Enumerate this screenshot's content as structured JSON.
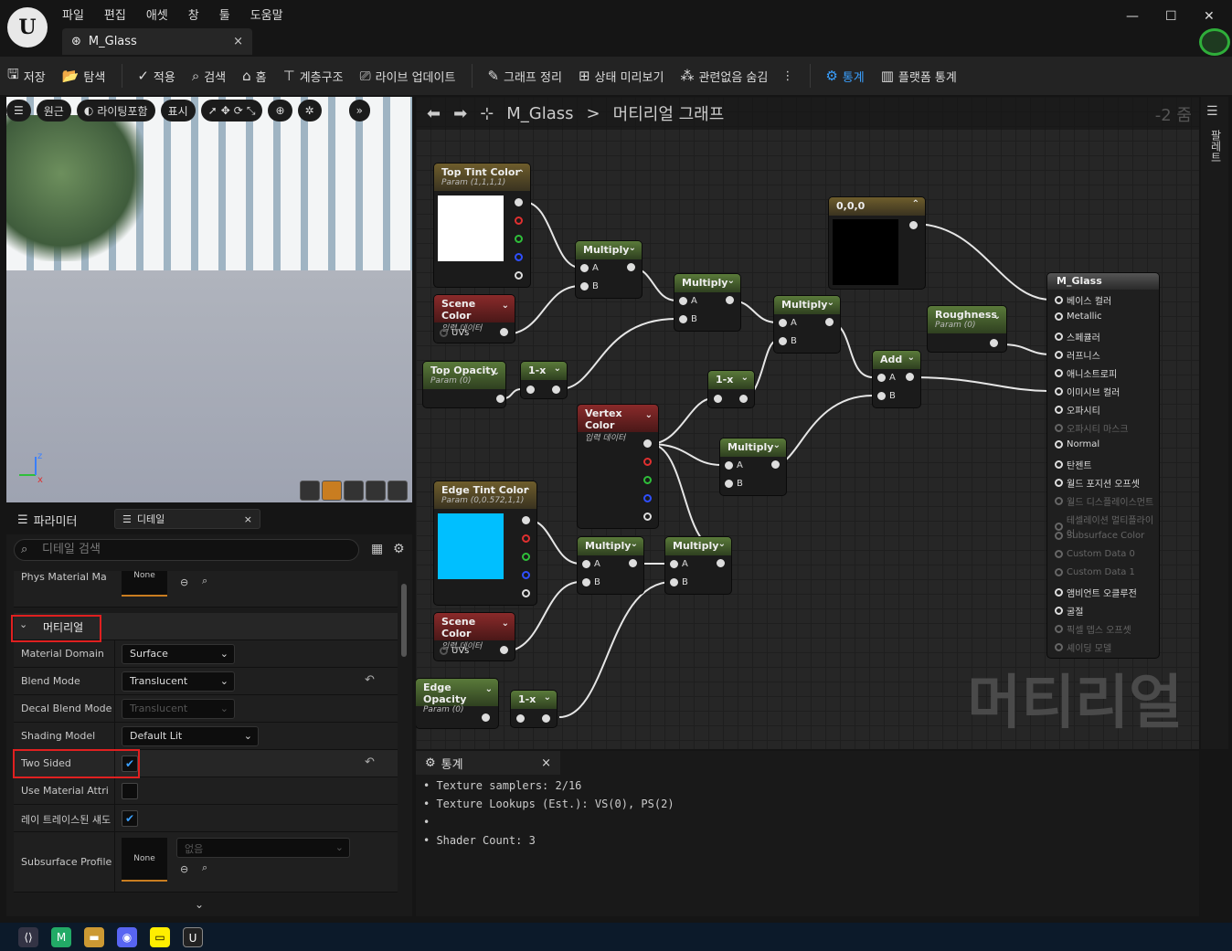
{
  "menu": [
    "파일",
    "편집",
    "애셋",
    "창",
    "툴",
    "도움말"
  ],
  "tab": {
    "title": "M_Glass",
    "close": "×"
  },
  "window_controls": [
    "—",
    "☐",
    "✕"
  ],
  "toolbar": [
    {
      "label": "저장",
      "icon": "save-icon"
    },
    {
      "label": "탐색",
      "icon": "browse-icon"
    },
    {
      "label": "적용",
      "icon": "apply-icon"
    },
    {
      "label": "검색",
      "icon": "search-icon"
    },
    {
      "label": "홈",
      "icon": "home-icon"
    },
    {
      "label": "계층구조",
      "icon": "hierarchy-icon"
    },
    {
      "label": "라이브 업데이트",
      "icon": "live-update-icon"
    },
    {
      "label": "그래프 정리",
      "icon": "clean-graph-icon"
    },
    {
      "label": "상태 미리보기",
      "icon": "preview-state-icon"
    },
    {
      "label": "관련없음 숨김",
      "icon": "hide-unrelated-icon"
    },
    {
      "label": "통계",
      "icon": "stats-icon"
    },
    {
      "label": "플랫폼 통계",
      "icon": "platform-stats-icon"
    }
  ],
  "viewport": {
    "buttons": [
      "원근",
      "라이팅포함",
      "표시"
    ]
  },
  "details": {
    "tabs": [
      "디테일",
      "파라미터"
    ],
    "tab_close": "×",
    "search_placeholder": "디테일 검색",
    "phys_label": "Phys Material Ma",
    "none": "None",
    "section": "머티리얼",
    "rows": [
      {
        "label": "Material Domain",
        "value": "Surface"
      },
      {
        "label": "Blend Mode",
        "value": "Translucent"
      },
      {
        "label": "Decal Blend Mode",
        "value": "Translucent"
      },
      {
        "label": "Shading Model",
        "value": "Default Lit"
      },
      {
        "label": "Two Sided",
        "value": "✔"
      },
      {
        "label": "Use Material Attri",
        "value": ""
      },
      {
        "label": "레이 트레이스된 섀도",
        "value": "✔"
      },
      {
        "label": "Subsurface Profile",
        "value": "없음"
      }
    ]
  },
  "graph": {
    "breadcrumb_asset": "M_Glass",
    "breadcrumb_sep": ">",
    "breadcrumb_graph": "머티리얼 그래프",
    "zoom": "-2 줌",
    "watermark": "머티리얼",
    "palette": "팔레트",
    "nodes": {
      "top_tint": {
        "title": "Top Tint Color",
        "sub": "Param (1,1,1,1)"
      },
      "scene1": {
        "title": "Scene Color",
        "sub": "입력 데이터",
        "pin": "UVs"
      },
      "top_opacity": {
        "title": "Top Opacity",
        "sub": "Param (0)"
      },
      "oneminus": "1-x",
      "multiply": "Multiply",
      "add": "Add",
      "A": "A",
      "B": "B",
      "const": {
        "title": "0,0,0"
      },
      "roughness": {
        "title": "Roughness",
        "sub": "Param (0)"
      },
      "vertex": {
        "title": "Vertex Color",
        "sub": "입력 데이터"
      },
      "edge_tint": {
        "title": "Edge Tint Color",
        "sub": "Param (0,0.572,1,1)"
      },
      "scene2": {
        "title": "Scene Color",
        "sub": "입력 데이터",
        "pin": "UVs"
      },
      "edge_opacity": {
        "title": "Edge Opacity",
        "sub": "Param (0)"
      }
    },
    "result": {
      "title": "M_Glass",
      "pins": [
        {
          "label": "베이스 컬러",
          "active": true
        },
        {
          "label": "Metallic",
          "active": true
        },
        {
          "label": "스페큘러",
          "active": true
        },
        {
          "label": "러프니스",
          "active": true
        },
        {
          "label": "애니소트로피",
          "active": true
        },
        {
          "label": "이미시브 컬러",
          "active": true
        },
        {
          "label": "오파시티",
          "active": true
        },
        {
          "label": "오파시티 마스크",
          "active": false
        },
        {
          "label": "Normal",
          "active": true
        },
        {
          "label": "탄젠트",
          "active": true
        },
        {
          "label": "월드 포지션 오프셋",
          "active": true
        },
        {
          "label": "월드 디스플레이스먼트",
          "active": false
        },
        {
          "label": "테셀레이션 멀티플라이어",
          "active": false
        },
        {
          "label": "Subsurface Color",
          "active": false
        },
        {
          "label": "Custom Data 0",
          "active": false
        },
        {
          "label": "Custom Data 1",
          "active": false
        },
        {
          "label": "앰비언트 오클루전",
          "active": true
        },
        {
          "label": "굴절",
          "active": true
        },
        {
          "label": "픽셀 뎁스 오프셋",
          "active": false
        },
        {
          "label": "셰이딩 모델",
          "active": false
        }
      ]
    }
  },
  "stats": {
    "tab": "통계",
    "close": "×",
    "lines": [
      "Texture samplers: 2/16",
      "Texture Lookups (Est.): VS(0), PS(2)",
      "",
      "Shader Count: 3"
    ]
  },
  "colors": {
    "accent": "#3aa0ff",
    "edge_tint": "#00bfff",
    "highlight": "#e02020"
  }
}
